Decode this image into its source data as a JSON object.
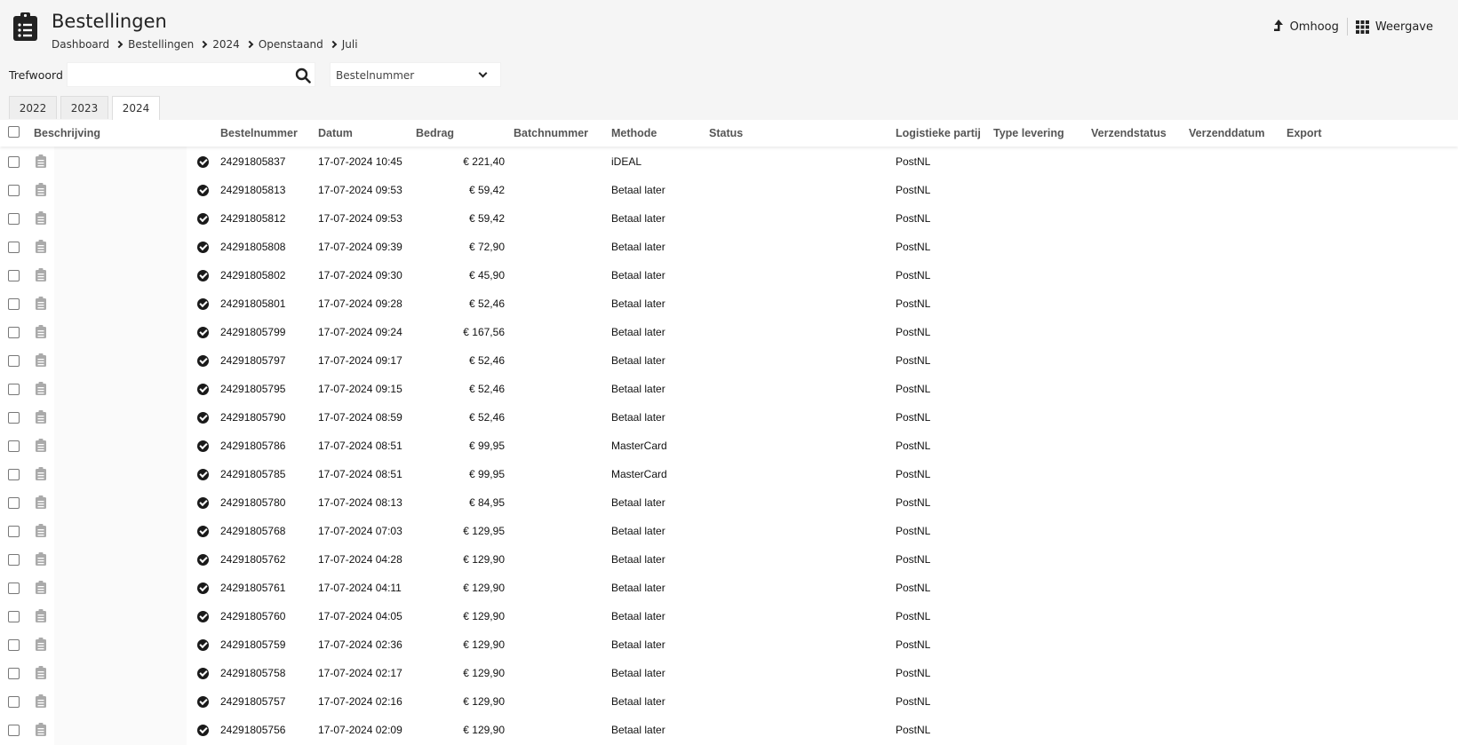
{
  "header": {
    "title": "Bestellingen",
    "breadcrumb": [
      "Dashboard",
      "Bestellingen",
      "2024",
      "Openstaand",
      "Juli"
    ],
    "actions": {
      "up": "Omhoog",
      "view": "Weergave"
    }
  },
  "search": {
    "label": "Trefwoord",
    "value": "",
    "field_select": "Bestelnummer"
  },
  "tabs": [
    "2022",
    "2023",
    "2024"
  ],
  "active_tab": "2024",
  "table": {
    "columns": {
      "beschrijving": "Beschrijving",
      "bestelnummer": "Bestelnummer",
      "datum": "Datum",
      "bedrag": "Bedrag",
      "batchnummer": "Batchnummer",
      "methode": "Methode",
      "status": "Status",
      "logistiek": "Logistieke partij",
      "type_levering": "Type levering",
      "verzendstatus": "Verzendstatus",
      "verzenddatum": "Verzenddatum",
      "export": "Export"
    },
    "rows": [
      {
        "nr": "24291805837",
        "date": "17-07-2024 10:45",
        "amount": "€ 221,40",
        "method": "iDEAL",
        "carrier": "PostNL"
      },
      {
        "nr": "24291805813",
        "date": "17-07-2024 09:53",
        "amount": "€ 59,42",
        "method": "Betaal later",
        "carrier": "PostNL"
      },
      {
        "nr": "24291805812",
        "date": "17-07-2024 09:53",
        "amount": "€ 59,42",
        "method": "Betaal later",
        "carrier": "PostNL"
      },
      {
        "nr": "24291805808",
        "date": "17-07-2024 09:39",
        "amount": "€ 72,90",
        "method": "Betaal later",
        "carrier": "PostNL"
      },
      {
        "nr": "24291805802",
        "date": "17-07-2024 09:30",
        "amount": "€ 45,90",
        "method": "Betaal later",
        "carrier": "PostNL"
      },
      {
        "nr": "24291805801",
        "date": "17-07-2024 09:28",
        "amount": "€ 52,46",
        "method": "Betaal later",
        "carrier": "PostNL"
      },
      {
        "nr": "24291805799",
        "date": "17-07-2024 09:24",
        "amount": "€ 167,56",
        "method": "Betaal later",
        "carrier": "PostNL"
      },
      {
        "nr": "24291805797",
        "date": "17-07-2024 09:17",
        "amount": "€ 52,46",
        "method": "Betaal later",
        "carrier": "PostNL"
      },
      {
        "nr": "24291805795",
        "date": "17-07-2024 09:15",
        "amount": "€ 52,46",
        "method": "Betaal later",
        "carrier": "PostNL"
      },
      {
        "nr": "24291805790",
        "date": "17-07-2024 08:59",
        "amount": "€ 52,46",
        "method": "Betaal later",
        "carrier": "PostNL"
      },
      {
        "nr": "24291805786",
        "date": "17-07-2024 08:51",
        "amount": "€ 99,95",
        "method": "MasterCard",
        "carrier": "PostNL"
      },
      {
        "nr": "24291805785",
        "date": "17-07-2024 08:51",
        "amount": "€ 99,95",
        "method": "MasterCard",
        "carrier": "PostNL"
      },
      {
        "nr": "24291805780",
        "date": "17-07-2024 08:13",
        "amount": "€ 84,95",
        "method": "Betaal later",
        "carrier": "PostNL"
      },
      {
        "nr": "24291805768",
        "date": "17-07-2024 07:03",
        "amount": "€ 129,95",
        "method": "Betaal later",
        "carrier": "PostNL"
      },
      {
        "nr": "24291805762",
        "date": "17-07-2024 04:28",
        "amount": "€ 129,90",
        "method": "Betaal later",
        "carrier": "PostNL"
      },
      {
        "nr": "24291805761",
        "date": "17-07-2024 04:11",
        "amount": "€ 129,90",
        "method": "Betaal later",
        "carrier": "PostNL"
      },
      {
        "nr": "24291805760",
        "date": "17-07-2024 04:05",
        "amount": "€ 129,90",
        "method": "Betaal later",
        "carrier": "PostNL"
      },
      {
        "nr": "24291805759",
        "date": "17-07-2024 02:36",
        "amount": "€ 129,90",
        "method": "Betaal later",
        "carrier": "PostNL"
      },
      {
        "nr": "24291805758",
        "date": "17-07-2024 02:17",
        "amount": "€ 129,90",
        "method": "Betaal later",
        "carrier": "PostNL"
      },
      {
        "nr": "24291805757",
        "date": "17-07-2024 02:16",
        "amount": "€ 129,90",
        "method": "Betaal later",
        "carrier": "PostNL"
      },
      {
        "nr": "24291805756",
        "date": "17-07-2024 02:09",
        "amount": "€ 129,90",
        "method": "Betaal later",
        "carrier": "PostNL"
      }
    ]
  },
  "icons": {
    "app": "clipboard-list-icon",
    "up": "arrow-up-icon",
    "view": "grid-icon",
    "search": "search-icon",
    "row_description": "clipboard-icon",
    "row_status": "check-circle-icon"
  },
  "colors": {
    "background": "#f5f5f5",
    "table_background": "#ffffff",
    "header_text": "#555555",
    "icon_dark": "#1a1a1a"
  }
}
